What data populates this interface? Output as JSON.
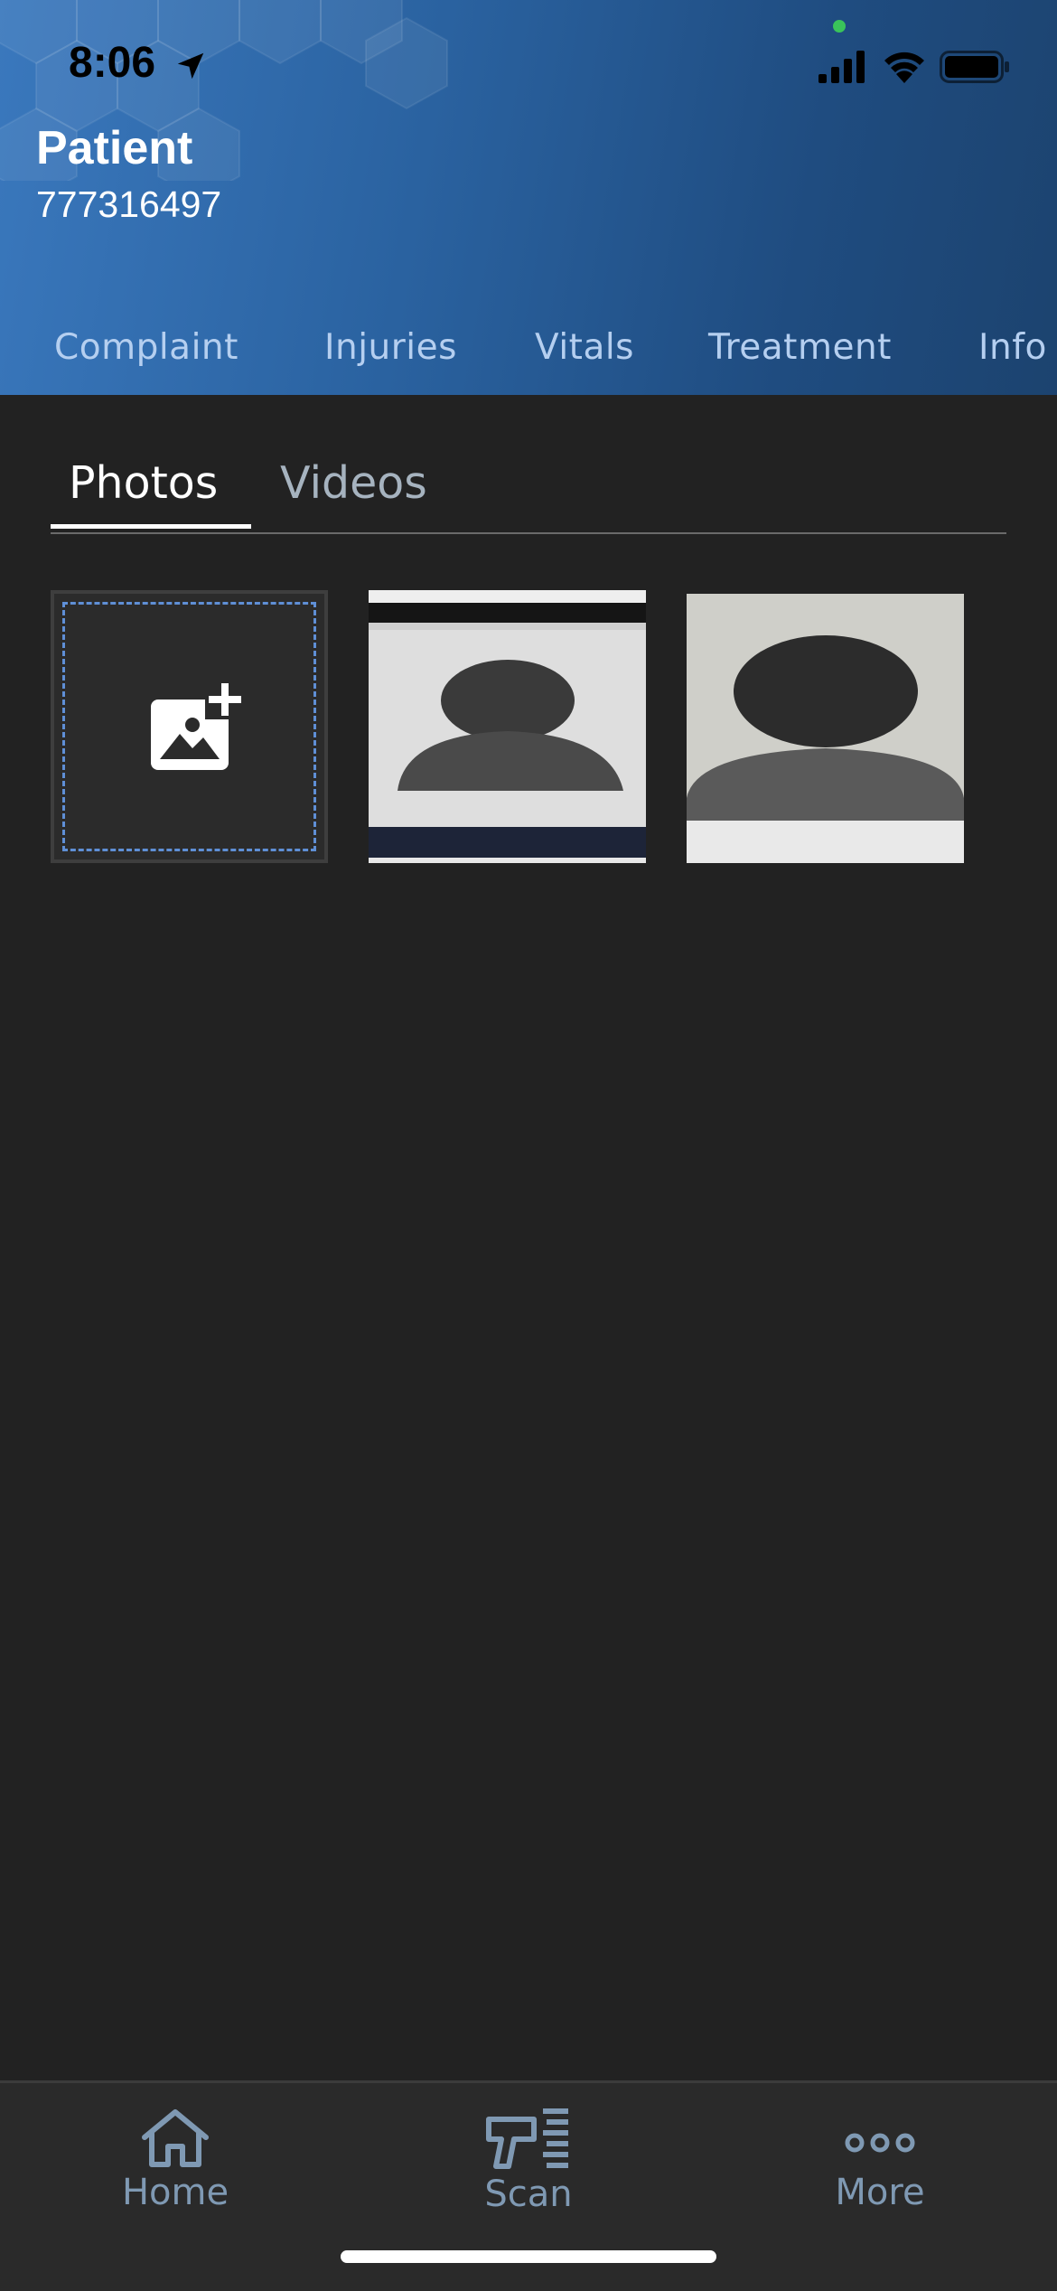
{
  "status_bar": {
    "time": "8:06"
  },
  "header": {
    "title": "Patient",
    "patient_id": "777316497"
  },
  "section_tabs": [
    {
      "label": "Complaint"
    },
    {
      "label": "Injuries"
    },
    {
      "label": "Vitals"
    },
    {
      "label": "Treatment"
    },
    {
      "label": "Info"
    }
  ],
  "media_tabs": {
    "photos": "Photos",
    "videos": "Videos",
    "selected": "Photos"
  },
  "photo_grid": {
    "add_icon": "add-photo-icon",
    "photos": [
      {
        "subject": "avatar-placeholder"
      },
      {
        "subject": "avatar-placeholder"
      }
    ]
  },
  "bottom_nav": {
    "items": [
      {
        "label": "Home",
        "icon": "home-icon"
      },
      {
        "label": "Scan",
        "icon": "barcode-scanner-icon"
      },
      {
        "label": "More",
        "icon": "more-icon"
      }
    ]
  },
  "colors": {
    "accent": "#2f6aab",
    "background": "#222222",
    "tab_text": "#b5cff0",
    "nav_text": "#7f99b3",
    "dashed_border": "#5f8fd6"
  }
}
